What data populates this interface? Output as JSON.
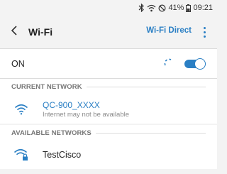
{
  "status_bar": {
    "battery": "41%",
    "time": "09:21",
    "icons": [
      "bluetooth-icon",
      "wifi-signal-icon",
      "do-not-disturb-icon",
      "battery-icon"
    ]
  },
  "app_bar": {
    "back_icon": "chevron-left-icon",
    "title": "Wi-Fi",
    "direct_label": "Wi-Fi Direct",
    "more_icon": "more-vertical-icon"
  },
  "wifi_toggle": {
    "label": "ON",
    "state": true
  },
  "current_network": {
    "header": "CURRENT NETWORK",
    "name": "QC-900_XXXX",
    "status": "Internet may not be available"
  },
  "available_networks": {
    "header": "AVAILABLE NETWORKS",
    "items": [
      {
        "name": "TestCisco",
        "secured": true
      }
    ]
  },
  "colors": {
    "accent": "#2a7fc4",
    "background": "#f3f3f3",
    "list_bg": "#ffffff",
    "muted_text": "#777777"
  }
}
